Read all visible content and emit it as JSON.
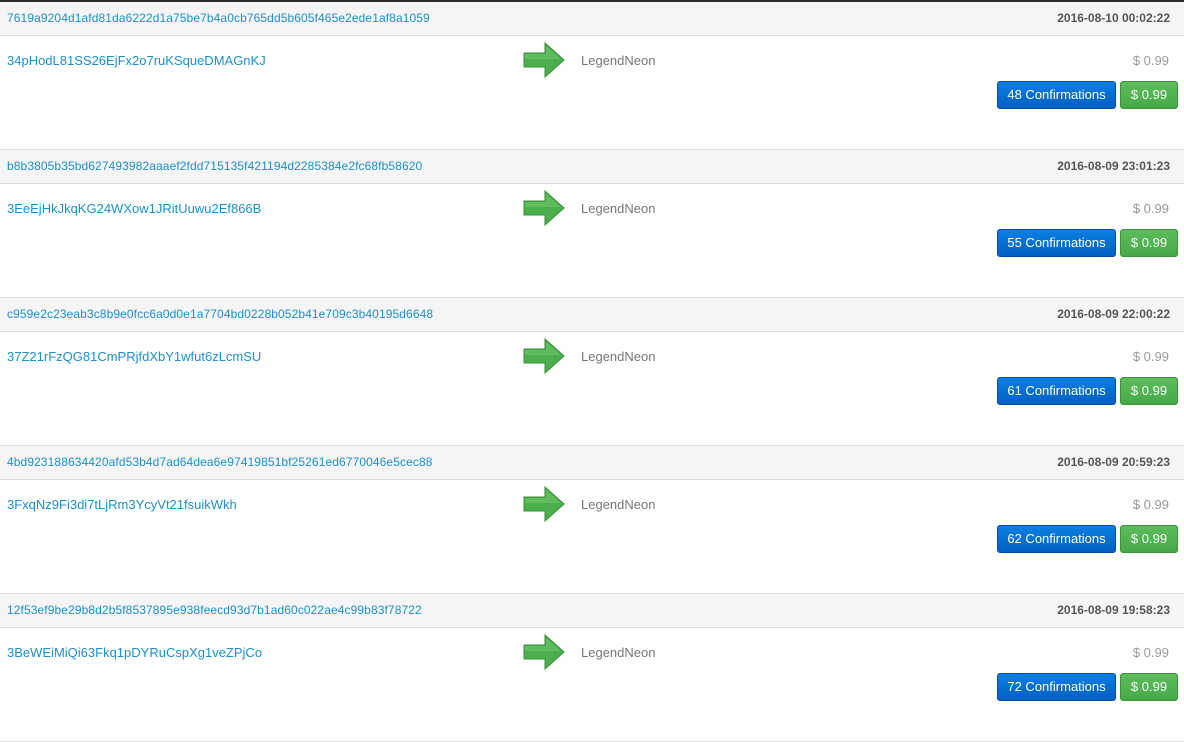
{
  "colors": {
    "link": "#1d8fcc",
    "confirmations_button": "#0a6fd6",
    "value_button": "#52b052",
    "arrow": "#4cae4c"
  },
  "transactions": [
    {
      "hash": "7619a9204d1afd81da6222d1a75be7b4a0cb765dd5b605f465e2ede1af8a1059",
      "time": "2016-08-10 00:02:22",
      "from": "34pHodL81SS26EjFx2o7ruKSqueDMAGnKJ",
      "arrow_icon": "right-arrow-icon",
      "to": "LegendNeon",
      "amount": "$ 0.99",
      "confirmations": "48 Confirmations",
      "value": "$ 0.99"
    },
    {
      "hash": "b8b3805b35bd627493982aaaef2fdd715135f421194d2285384e2fc68fb58620",
      "time": "2016-08-09 23:01:23",
      "from": "3EeEjHkJkqKG24WXow1JRitUuwu2Ef866B",
      "arrow_icon": "right-arrow-icon",
      "to": "LegendNeon",
      "amount": "$ 0.99",
      "confirmations": "55 Confirmations",
      "value": "$ 0.99"
    },
    {
      "hash": "c959e2c23eab3c8b9e0fcc6a0d0e1a7704bd0228b052b41e709c3b40195d6648",
      "time": "2016-08-09 22:00:22",
      "from": "37Z21rFzQG81CmPRjfdXbY1wfut6zLcmSU",
      "arrow_icon": "right-arrow-icon",
      "to": "LegendNeon",
      "amount": "$ 0.99",
      "confirmations": "61 Confirmations",
      "value": "$ 0.99"
    },
    {
      "hash": "4bd923188634420afd53b4d7ad64dea6e97419851bf25261ed6770046e5cec88",
      "time": "2016-08-09 20:59:23",
      "from": "3FxqNz9Fi3di7tLjRm3YcyVt21fsuikWkh",
      "arrow_icon": "right-arrow-icon",
      "to": "LegendNeon",
      "amount": "$ 0.99",
      "confirmations": "62 Confirmations",
      "value": "$ 0.99"
    },
    {
      "hash": "12f53ef9be29b8d2b5f8537895e938feecd93d7b1ad60c022ae4c99b83f78722",
      "time": "2016-08-09 19:58:23",
      "from": "3BeWEiMiQi63Fkq1pDYRuCspXg1veZPjCo",
      "arrow_icon": "right-arrow-icon",
      "to": "LegendNeon",
      "amount": "$ 0.99",
      "confirmations": "72 Confirmations",
      "value": "$ 0.99"
    }
  ]
}
